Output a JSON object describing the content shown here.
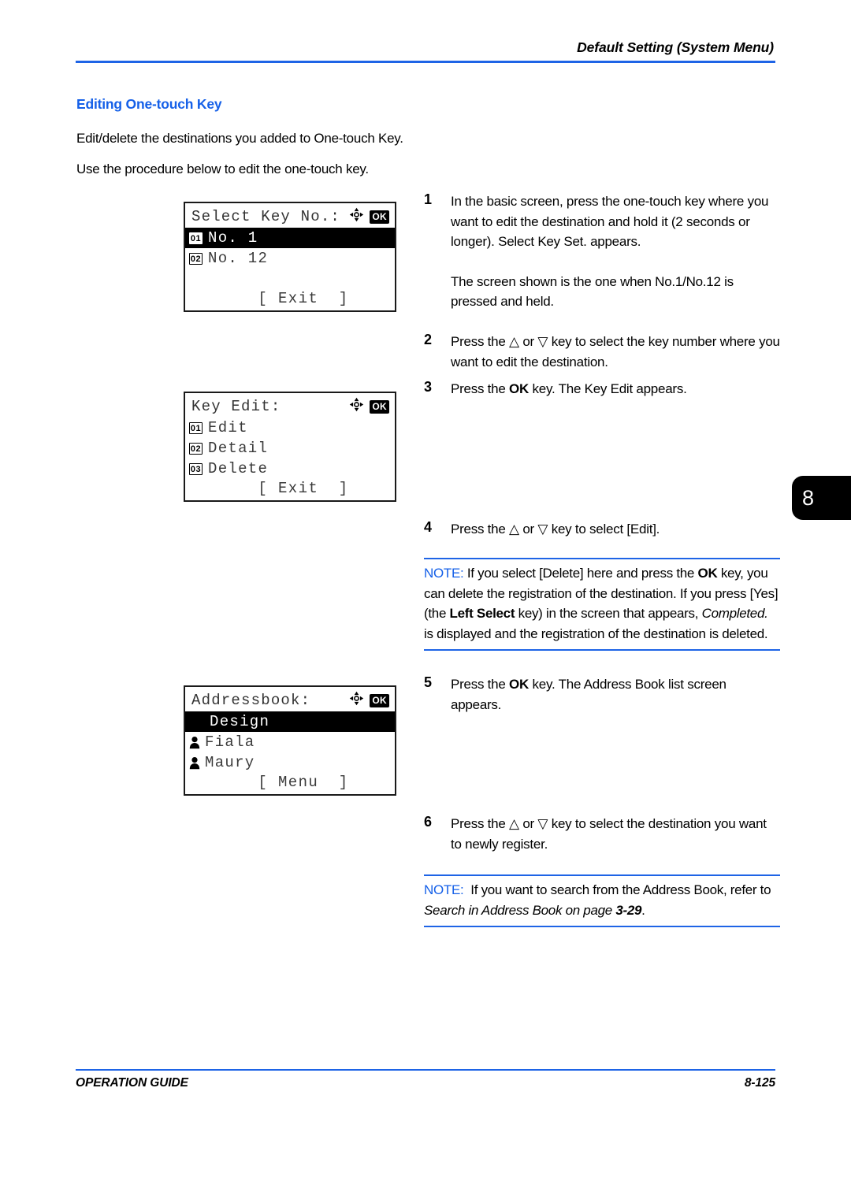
{
  "header": {
    "running_title": "Default Setting (System Menu)"
  },
  "section": {
    "title": "Editing One-touch Key",
    "intro_1": "Edit/delete the destinations you added to One-touch Key.",
    "intro_2": "Use the procedure below to edit the one-touch key."
  },
  "screens": [
    {
      "name": "select-key-no",
      "title": "Select Key No.:",
      "dpad_icon": "dpad-icon",
      "ok_icon": "OK",
      "rows": [
        {
          "badge": "01",
          "label": "No. 1",
          "selected": true
        },
        {
          "badge": "02",
          "label": "No. 12",
          "selected": false
        }
      ],
      "softkey": "[ Exit  ]"
    },
    {
      "name": "key-edit",
      "title": "Key Edit:",
      "dpad_icon": "dpad-icon",
      "ok_icon": "OK",
      "rows": [
        {
          "badge": "01",
          "label": "Edit",
          "selected": false
        },
        {
          "badge": "02",
          "label": "Detail",
          "selected": false
        },
        {
          "badge": "03",
          "label": "Delete",
          "selected": false
        }
      ],
      "softkey": "[ Exit  ]"
    },
    {
      "name": "addressbook",
      "title": "Addressbook:",
      "dpad_icon": "dpad-icon",
      "ok_icon": "OK",
      "rows": [
        {
          "icon": "group-icon",
          "label": "Design",
          "selected": true
        },
        {
          "icon": "person-icon",
          "label": "Fiala",
          "selected": false
        },
        {
          "icon": "person-icon",
          "label": "Maury",
          "selected": false
        }
      ],
      "softkey": "[ Menu  ]"
    }
  ],
  "steps": [
    {
      "number": "1",
      "paragraphs": [
        "In the basic screen, press the one-touch key where you want to edit the destination and hold it (2 seconds or longer). Select Key Set. appears.",
        "The screen shown is the one when No.1/No.12 is pressed and held."
      ]
    },
    {
      "number": "2",
      "paragraphs": [
        "Press the △ or ▽ key to select the key number where you want to edit the destination."
      ]
    },
    {
      "number": "3",
      "paragraphs": [
        "Press the OK key. The Key Edit appears."
      ]
    },
    {
      "number": "4",
      "paragraphs": [
        "Press the △ or ▽ key to select [Edit]."
      ]
    },
    {
      "number": "5",
      "paragraphs": [
        "Press the OK key. The Address Book list screen appears."
      ]
    },
    {
      "number": "6",
      "paragraphs": [
        "Press the △ or ▽ key to select the destination you want to newly register."
      ]
    }
  ],
  "notes": [
    {
      "label": "NOTE:",
      "text": "If you select [Delete] here and press the OK key, you can delete the registration of the destination. If you press [Yes] (the Left Select key) in the screen that appears, Completed. is displayed and the registration of the destination is deleted."
    },
    {
      "label": "NOTE:",
      "text": "If you want to search from the Address Book, refer to Search in Address Book on page 3-29."
    }
  ],
  "chapter_tab": {
    "number": "8"
  },
  "footer": {
    "guide_label": "OPERATION GUIDE",
    "page_number": "8-125"
  },
  "colors": {
    "accent_blue": "#1560E8",
    "rule_blue": "#1E64E6"
  }
}
